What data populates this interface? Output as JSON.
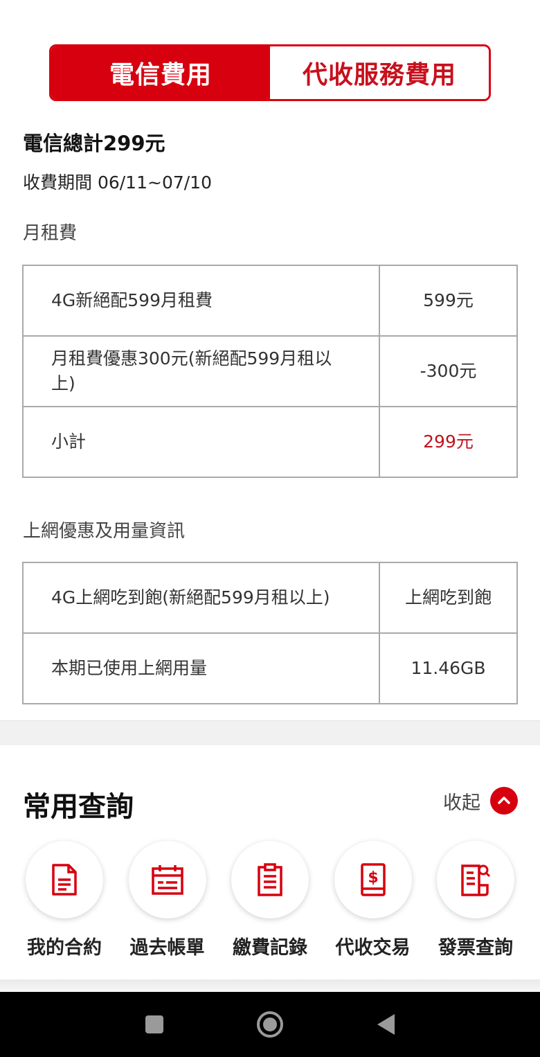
{
  "tabs": {
    "telecom": "電信費用",
    "collection": "代收服務費用"
  },
  "summary": {
    "total": "電信總計299元",
    "period": "收費期間 06/11~07/10"
  },
  "monthly_fee": {
    "title": "月租費",
    "rows": [
      {
        "label": "4G新絕配599月租費",
        "value": "599元"
      },
      {
        "label": "月租費優惠300元(新絕配599月租以上)",
        "value": "-300元"
      },
      {
        "label": "小計",
        "value": "299元"
      }
    ]
  },
  "data_usage": {
    "title": "上網優惠及用量資訊",
    "rows": [
      {
        "label": "4G上網吃到飽(新絕配599月租以上)",
        "value": "上網吃到飽"
      },
      {
        "label": "本期已使用上網用量",
        "value": "11.46GB"
      }
    ]
  },
  "quick": {
    "title": "常用查詢",
    "collapse_label": "收起",
    "items": [
      {
        "label": "我的合約",
        "icon": "document-icon"
      },
      {
        "label": "過去帳單",
        "icon": "calendar-icon"
      },
      {
        "label": "繳費記錄",
        "icon": "clipboard-icon"
      },
      {
        "label": "代收交易",
        "icon": "dollar-phone-icon"
      },
      {
        "label": "發票查詢",
        "icon": "invoice-search-icon"
      }
    ]
  },
  "colors": {
    "accent": "#d7000f",
    "highlight_text": "#c0141f"
  }
}
